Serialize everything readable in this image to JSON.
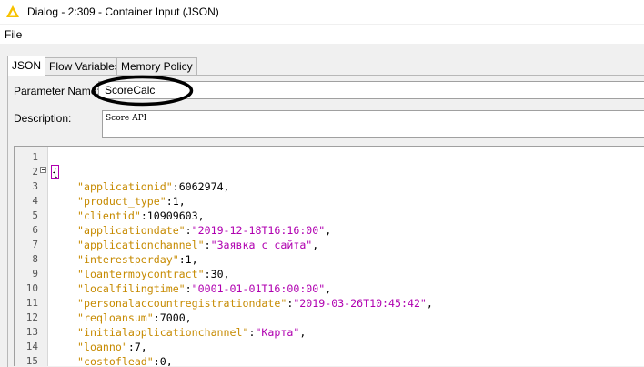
{
  "window": {
    "title": "Dialog - 2:309 - Container Input (JSON)"
  },
  "menu": {
    "items": [
      "File"
    ]
  },
  "tabs": [
    "JSON",
    "Flow Variables",
    "Memory Policy"
  ],
  "form": {
    "parameter_label": "Parameter Name:",
    "parameter_value": "ScoreCalc",
    "description_label": "Description:",
    "description_value": "Score API"
  },
  "editor": {
    "line_numbers": [
      "1",
      "2",
      "3",
      "4",
      "5",
      "6",
      "7",
      "8",
      "9",
      "10",
      "11",
      "12",
      "13",
      "14",
      "15"
    ],
    "lines": [
      {
        "key": "",
        "sep": "",
        "value": "",
        "type": "none"
      },
      {
        "key": "",
        "sep": "",
        "value": "{",
        "type": "brace"
      },
      {
        "key": "\"applicationid\"",
        "sep": ":",
        "value": "6062974,",
        "type": "num"
      },
      {
        "key": "\"product_type\"",
        "sep": ":",
        "value": "1,",
        "type": "num"
      },
      {
        "key": "\"clientid\"",
        "sep": ":",
        "value": "10909603,",
        "type": "num"
      },
      {
        "key": "\"applicationdate\"",
        "sep": ":",
        "value": "\"2019-12-18T16:16:00\"",
        "type": "str"
      },
      {
        "key": "\"applicationchannel\"",
        "sep": ":",
        "value": "\"Заявка с сайта\"",
        "type": "str"
      },
      {
        "key": "\"interestperday\"",
        "sep": ":",
        "value": "1,",
        "type": "num"
      },
      {
        "key": "\"loantermbycontract\"",
        "sep": ":",
        "value": "30,",
        "type": "num"
      },
      {
        "key": "\"localfilingtime\"",
        "sep": ":",
        "value": "\"0001-01-01T16:00:00\"",
        "type": "str"
      },
      {
        "key": "\"personalaccountregistrationdate\"",
        "sep": ":",
        "value": "\"2019-03-26T10:45:42\"",
        "type": "str"
      },
      {
        "key": "\"reqloansum\"",
        "sep": ":",
        "value": "7000,",
        "type": "num"
      },
      {
        "key": "\"initialapplicationchannel\"",
        "sep": ":",
        "value": "\"Карта\"",
        "type": "str"
      },
      {
        "key": "\"loanno\"",
        "sep": ":",
        "value": "7,",
        "type": "num"
      },
      {
        "key": "\"costoflead\"",
        "sep": ":",
        "value": "0,",
        "type": "num"
      }
    ]
  },
  "colors": {
    "json_key": "#c68a00",
    "json_string": "#b000b0",
    "annotation_ellipse": "#000000"
  }
}
